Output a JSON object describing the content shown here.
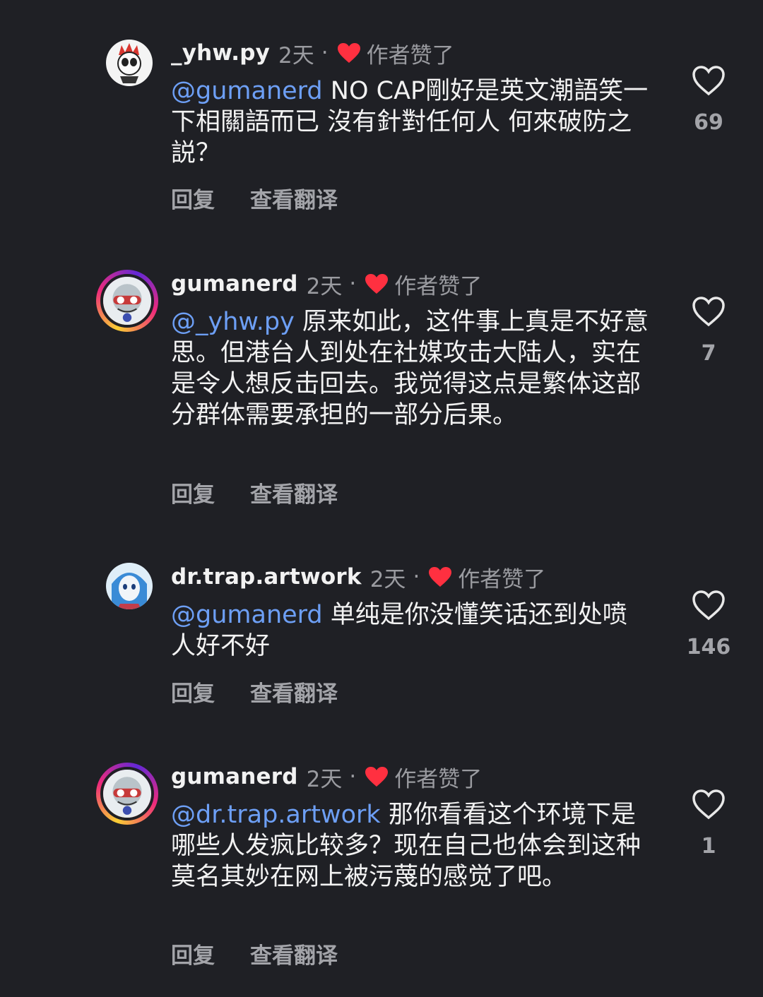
{
  "comments": [
    {
      "username": "_yhw.py",
      "time": "2天",
      "liked_label": "作者赞了",
      "mention": "@gumanerd",
      "text": " NO CAP剛好是英文潮語笑一下相關語而已 沒有針對任何人 何來破防之説？",
      "reply": "回复",
      "translate": "查看翻译",
      "likes": "69"
    },
    {
      "username": "gumanerd",
      "time": "2天",
      "liked_label": "作者赞了",
      "mention": "@_yhw.py",
      "text": " 原来如此，这件事上真是不好意思。但港台人到处在社媒攻击大陆人，实在是令人想反击回去。我觉得这点是繁体这部分群体需要承担的一部分后果。",
      "reply": "回复",
      "translate": "查看翻译",
      "likes": "7"
    },
    {
      "username": "dr.trap.artwork",
      "time": "2天",
      "liked_label": "作者赞了",
      "mention": "@gumanerd",
      "text": " 单纯是你没懂笑话还到处喷人好不好",
      "reply": "回复",
      "translate": "查看翻译",
      "likes": "146"
    },
    {
      "username": "gumanerd",
      "time": "2天",
      "liked_label": "作者赞了",
      "mention": "@dr.trap.artwork",
      "text": " 那你看看这个环境下是哪些人发疯比较多？现在自己也体会到这种莫名其妙在网上被污蔑的感觉了吧。",
      "reply": "回复",
      "translate": "查看翻译",
      "likes": "1"
    }
  ],
  "colors": {
    "background": "#1f2025",
    "mention": "#6d9ff5",
    "heart": "#ff3040"
  }
}
